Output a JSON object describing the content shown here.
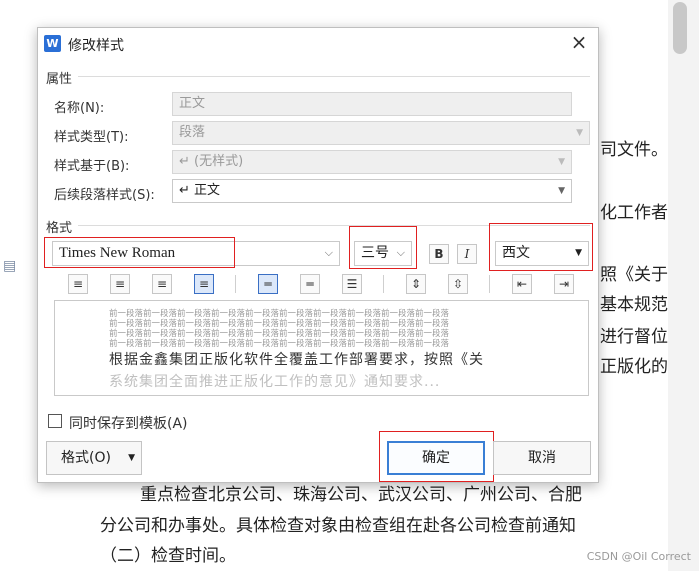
{
  "background_doc": {
    "lines": [
      "司文件。",
      "化工作者",
      "照《关于",
      "基本规范",
      "进行督位",
      "正版化的",
      "重点检查北京公司、珠海公司、武汉公司、广州公司、合肥",
      "分公司和办事处。具体检查对象由检查组在赴各公司检查前通知",
      "（二）检查时间。"
    ],
    "watermark": "CSDN @Oil Correct"
  },
  "dialog": {
    "title": "修改样式",
    "attributes": {
      "section": "属性",
      "name_label": "名称(N):",
      "name_value": "正文",
      "type_label": "样式类型(T):",
      "type_value": "段落",
      "based_label": "样式基于(B):",
      "based_value": "↵ (无样式)",
      "next_label": "后续段落样式(S):",
      "next_value": "↵ 正文"
    },
    "format": {
      "section": "格式",
      "font": "Times New Roman",
      "size": "三号",
      "bold": "B",
      "italic": "I",
      "script": "西文"
    },
    "preview": {
      "grey_line": "前一段落前一段落前一段落前一段落前一段落前一段落前一段落前一段落前一段落前一段落",
      "main_text": "根据金鑫集团正版化软件全覆盖工作部署要求，按照《关",
      "faded_text": "系统集团全面推进正版化工作的意见》通知要求..."
    },
    "save_template": "同时保存到模板(A)",
    "buttons": {
      "format": "格式(O)",
      "ok": "确定",
      "cancel": "取消"
    }
  }
}
